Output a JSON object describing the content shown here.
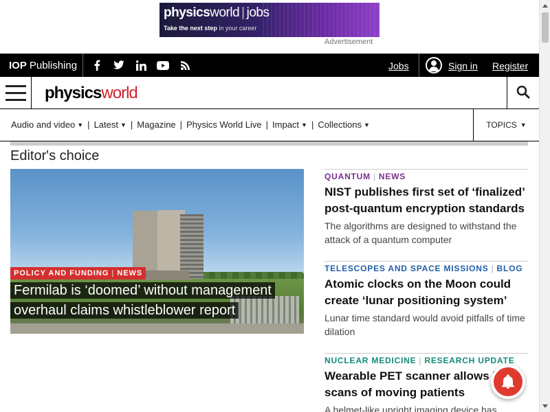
{
  "ad": {
    "brand_main": "physics",
    "brand_world": "world",
    "brand_jobs": "jobs",
    "tagline_bold": "Take the next step",
    "tagline_rest": " in your career",
    "label": "Advertisement"
  },
  "topbar": {
    "publisher_bold": "IOP",
    "publisher_rest": "Publishing",
    "socials": [
      "facebook-icon",
      "twitter-icon",
      "linkedin-icon",
      "youtube-icon",
      "rss-icon"
    ],
    "jobs": "Jobs",
    "sign_in": "Sign in",
    "register": "Register"
  },
  "logo": {
    "part1": "physics",
    "part2": "world"
  },
  "nav": {
    "items": [
      {
        "label": "Audio and video",
        "caret": true
      },
      {
        "label": "Latest",
        "caret": true
      },
      {
        "label": "Magazine",
        "caret": false
      },
      {
        "label": "Physics World Live",
        "caret": false
      },
      {
        "label": "Impact",
        "caret": true
      },
      {
        "label": "Collections",
        "caret": true
      }
    ],
    "topics": "TOPICS"
  },
  "main": {
    "section_title": "Editor's choice",
    "hero": {
      "category": "POLICY AND FUNDING",
      "type": "NEWS",
      "title": "Fermilab is ‘doomed’ without management overhaul claims whistleblower report"
    },
    "articles": [
      {
        "category": "QUANTUM",
        "type": "NEWS",
        "color": "#7b2d8e",
        "title": "NIST publishes first set of ‘finalized’ post-quantum encryption standards",
        "desc": "The algorithms are designed to withstand the attack of a quantum computer"
      },
      {
        "category": "TELESCOPES AND SPACE MISSIONS",
        "type": "BLOG",
        "color": "#1f5ea8",
        "title": "Atomic clocks on the Moon could create ‘lunar positioning system’",
        "desc": "Lunar time standard would avoid pitfalls of time dilation"
      },
      {
        "category": "NUCLEAR MEDICINE",
        "type": "RESEARCH UPDATE",
        "color": "#0f8a7a",
        "title": "Wearable PET scanner allows brain scans of moving patients",
        "desc": "A helmet-like upright imaging device has"
      }
    ]
  },
  "colors": {
    "brand_red": "#d4202c",
    "badge_red": "#d32f2f",
    "bell_red": "#e03a30"
  }
}
